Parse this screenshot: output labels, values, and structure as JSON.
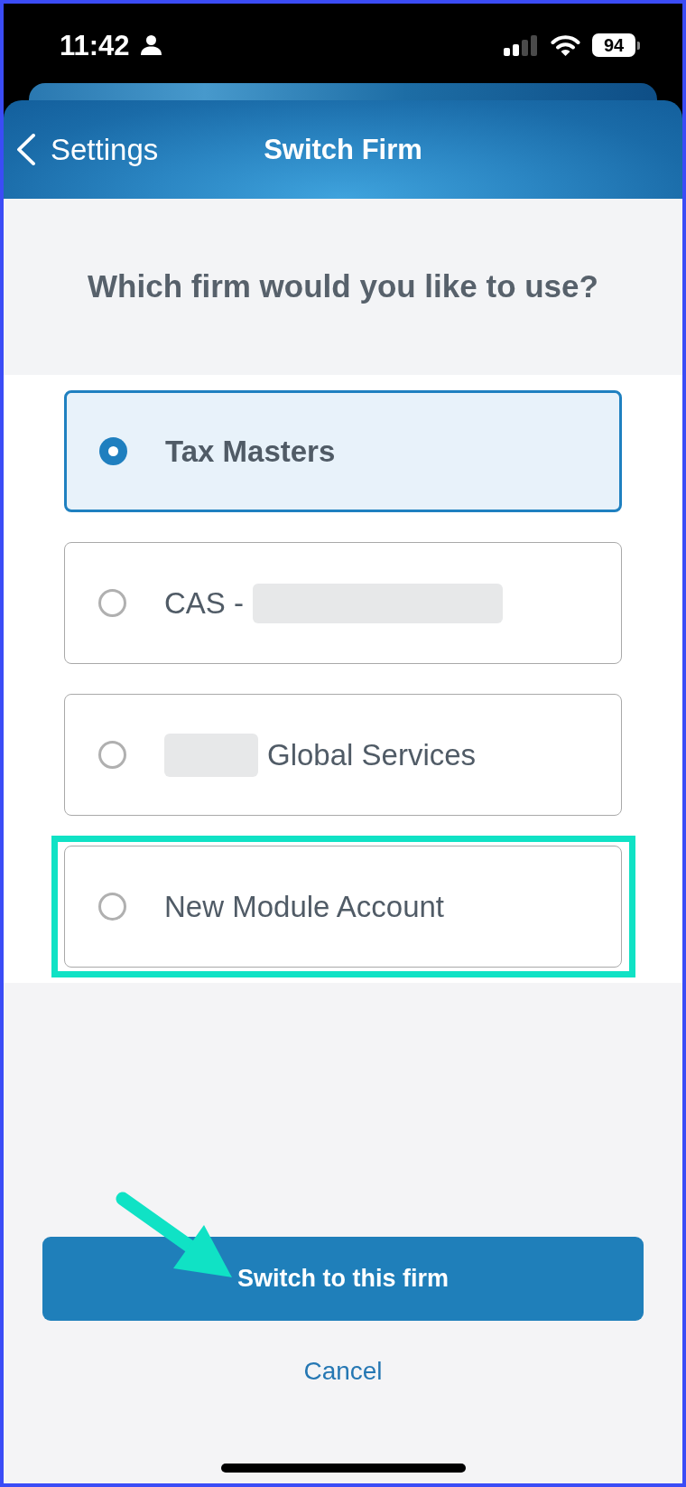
{
  "status_bar": {
    "time": "11:42",
    "battery": "94"
  },
  "nav": {
    "back": "Settings",
    "title": "Switch Firm"
  },
  "prompt": "Which firm would you like to use?",
  "firms": [
    {
      "selected": true,
      "highlighted": false,
      "parts": [
        {
          "kind": "text",
          "text": "Tax Masters"
        }
      ]
    },
    {
      "selected": false,
      "highlighted": false,
      "parts": [
        {
          "kind": "text",
          "text": "CAS -"
        },
        {
          "kind": "redacted"
        }
      ]
    },
    {
      "selected": false,
      "highlighted": false,
      "parts": [
        {
          "kind": "redacted"
        },
        {
          "kind": "text",
          "text": "Global Services"
        }
      ]
    },
    {
      "selected": false,
      "highlighted": true,
      "parts": [
        {
          "kind": "text",
          "text": "New Module Account"
        }
      ]
    }
  ],
  "primary_button": "Switch to this firm",
  "cancel": "Cancel"
}
